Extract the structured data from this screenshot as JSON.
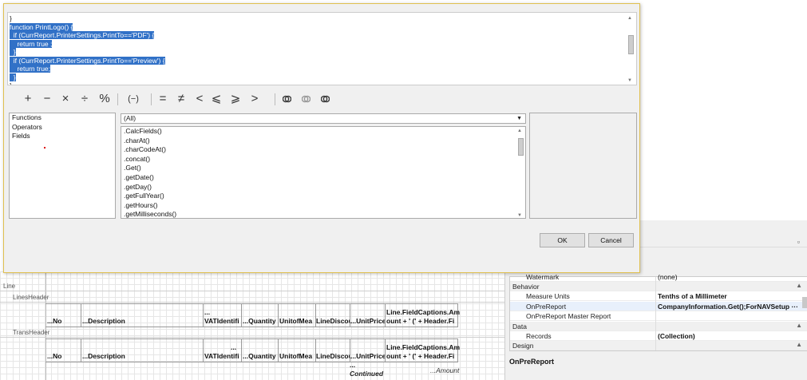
{
  "code_editor": {
    "lines": [
      {
        "text": "}",
        "selected": false
      },
      {
        "text": "function PrintLogo() {",
        "selected": true
      },
      {
        "text": "  if (CurrReport.PrinterSettings.PrintTo=='PDF') {",
        "selected": true
      },
      {
        "text": "    return true ;",
        "selected": true
      },
      {
        "text": "  }",
        "selected": true
      },
      {
        "text": "  if (CurrReport.PrinterSettings.PrintTo=='Preview') {",
        "selected": true
      },
      {
        "text": "    return true;",
        "selected": true
      },
      {
        "text": "  }",
        "selected": true
      },
      {
        "text": "}",
        "selected": false
      }
    ]
  },
  "toolbar": {
    "operators": [
      {
        "symbol": "+",
        "name": "plus"
      },
      {
        "symbol": "−",
        "name": "minus"
      },
      {
        "symbol": "×",
        "name": "multiply"
      },
      {
        "symbol": "÷",
        "name": "divide"
      },
      {
        "symbol": "%",
        "name": "modulo"
      },
      {
        "symbol": "(−)",
        "name": "negate"
      },
      {
        "symbol": "=",
        "name": "equal"
      },
      {
        "symbol": "≠",
        "name": "not-equal"
      },
      {
        "symbol": "<",
        "name": "less"
      },
      {
        "symbol": "⩽",
        "name": "less-equal"
      },
      {
        "symbol": "⩾",
        "name": "greater-equal"
      },
      {
        "symbol": ">",
        "name": "greater"
      }
    ],
    "logic_icons": [
      "and-icon",
      "or-icon",
      "not-icon"
    ]
  },
  "categories": [
    "Functions",
    "Operators",
    "Fields"
  ],
  "filter": {
    "value": "(All)"
  },
  "functions": [
    ".CalcFields()",
    ".charAt()",
    ".charCodeAt()",
    ".concat()",
    ".Get()",
    ".getDate()",
    ".getDay()",
    ".getFullYear()",
    ".getHours()",
    ".getMilliseconds()"
  ],
  "buttons": {
    "ok": "OK",
    "cancel": "Cancel"
  },
  "designer": {
    "bands": {
      "line": "Line",
      "lines_header": "LinesHeader",
      "trans_header": "TransHeader"
    },
    "row1": {
      "no": "...No",
      "description": "...Description",
      "vat": "VATIdentifi",
      "vat_top": "...",
      "quantity": "...Quantity",
      "unit": "UnitofMea",
      "disc": "LineDiscou",
      "price": "...UnitPrice",
      "fc1": "Line.FieldCaptions.Am",
      "fc2": "ount + ' (' + Header.Fi"
    },
    "row2": {
      "no": "...No",
      "description": "...Description",
      "vat": "VATIdentifi",
      "vat_top": "...",
      "quantity": "...Quantity",
      "unit": "UnitofMea",
      "disc": "LineDiscou",
      "price": "...UnitPrice",
      "fc1": "Line.FieldCaptions.Am",
      "fc2": "ount + ' (' + Header.Fi"
    },
    "continued": "Continued",
    "continued_top": "...",
    "amount": "...Amount"
  },
  "properties": {
    "cut_row": {
      "name": "Watermark",
      "value": "(none)"
    },
    "rows": [
      {
        "name": "Behavior",
        "value": "",
        "category": true
      },
      {
        "name": "Measure Units",
        "value": "Tenths of a Millimeter",
        "category": false
      },
      {
        "name": "OnPreReport",
        "value": "CompanyInformation.Get();ForNAVSetup ···",
        "category": false
      },
      {
        "name": "OnPreReport Master Report",
        "value": "",
        "category": false
      },
      {
        "name": "Data",
        "value": "",
        "category": true
      },
      {
        "name": "Records",
        "value": "(Collection)",
        "category": false
      },
      {
        "name": "Design",
        "value": "",
        "category": true
      }
    ],
    "description_title": "OnPreReport"
  }
}
